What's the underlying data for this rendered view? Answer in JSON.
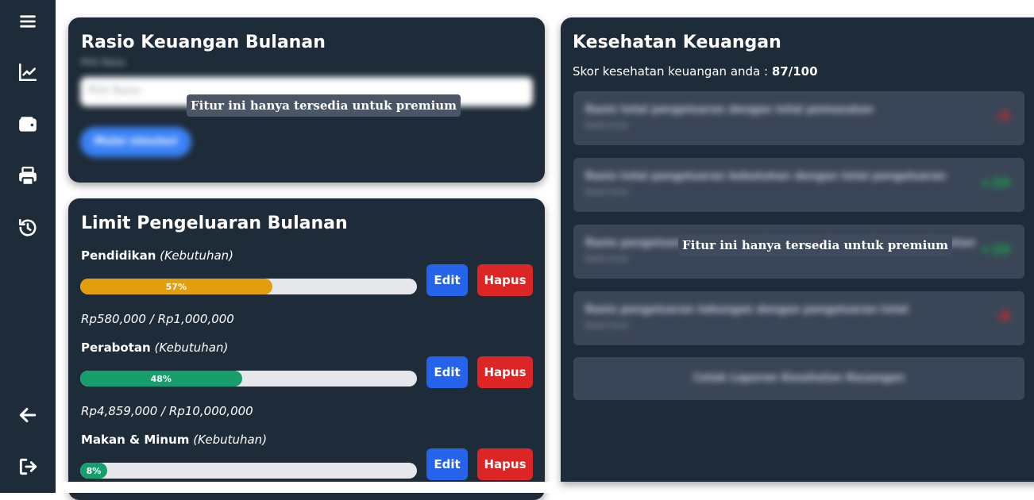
{
  "sidebar": {
    "items": [
      {
        "icon": "menu-icon"
      },
      {
        "icon": "chart-line-icon"
      },
      {
        "icon": "wallet-icon"
      },
      {
        "icon": "printer-icon"
      },
      {
        "icon": "history-icon"
      },
      {
        "icon": "arrow-left-icon"
      },
      {
        "icon": "logout-icon"
      }
    ]
  },
  "rasio": {
    "title": "Rasio Keuangan Bulanan",
    "select_label": "Pilih Rasio",
    "select_placeholder": "Pilih Rasio",
    "start_button": "Mulai simulasi",
    "premium_tooltip": "Fitur ini hanya tersedia untuk premium"
  },
  "limit": {
    "title": "Limit Pengeluaran Bulanan",
    "edit_label": "Edit",
    "delete_label": "Hapus",
    "items": [
      {
        "name": "Pendidikan",
        "type": "(Kebutuhan)",
        "percent": 57,
        "percent_label": "57%",
        "color": "#e29e0c",
        "amount": "Rp580,000 / Rp1,000,000"
      },
      {
        "name": "Perabotan",
        "type": "(Kebutuhan)",
        "percent": 48,
        "percent_label": "48%",
        "color": "#169e6c",
        "amount": "Rp4,859,000 / Rp10,000,000"
      },
      {
        "name": "Makan & Minum",
        "type": "(Kebutuhan)",
        "percent": 8,
        "percent_label": "8%",
        "color": "#169e6c",
        "amount": ""
      }
    ]
  },
  "kesehatan": {
    "title": "Kesehatan Keuangan",
    "score_prefix": "Skor kesehatan keuangan anda : ",
    "score_value": "87/100",
    "premium_tooltip": "Fitur ini hanya tersedia untuk premium",
    "ratios": [
      {
        "text": "Rasio total pengeluaran dengan total pemasukan",
        "sub": "Read more",
        "score": "-5",
        "color": "#dc2626"
      },
      {
        "text": "Rasio total pengeluaran kebutuhan dengan total pengeluaran",
        "sub": "Read more",
        "score": "+20",
        "color": "#16a34a"
      },
      {
        "text": "Rasio pengeluaran keinginan dengan total pengeluaran kebutuhan",
        "sub": "Read more",
        "score": "+20",
        "color": "#16a34a"
      },
      {
        "text": "Rasio pengeluaran tabungan dengan pengeluaran total",
        "sub": "Read more",
        "score": "-8",
        "color": "#dc2626"
      }
    ],
    "print_button": "Cetak Laporan Kesehatan Keuangan"
  }
}
